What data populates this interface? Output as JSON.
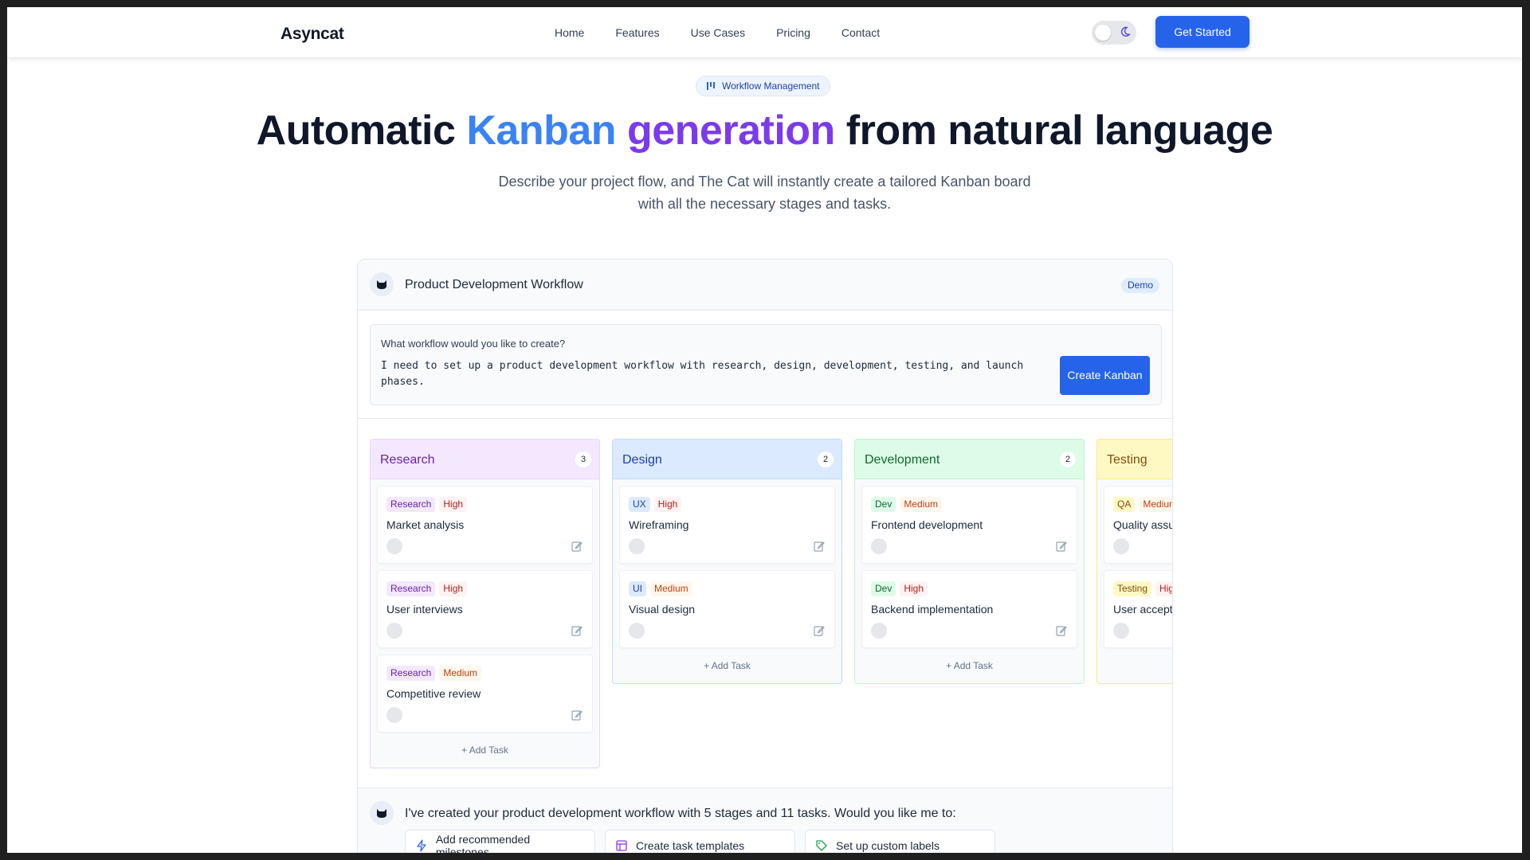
{
  "nav": {
    "brand": "Asyncat",
    "links": [
      "Home",
      "Features",
      "Use Cases",
      "Pricing",
      "Contact"
    ],
    "cta": "Get Started"
  },
  "hero": {
    "pill": "Workflow Management",
    "title_before": "Automatic ",
    "title_word1": "Kanban",
    "title_word2": "generation",
    "title_after": " from natural language",
    "subtitle_line1": "Describe your project flow, and The Cat will instantly create a tailored Kanban board",
    "subtitle_line2": "with all the necessary stages and tasks."
  },
  "demo": {
    "title": "Product Development Workflow",
    "badge": "Demo",
    "prompt_label": "What workflow would you like to create?",
    "prompt_text": "I need to set up a product development workflow with research, design, development, testing, and launch phases.",
    "create_button": "Create Kanban",
    "add_task_label": "+ Add Task"
  },
  "columns": [
    {
      "name": "Research",
      "count": "3",
      "head_bg": "#f3e8ff",
      "name_color": "#6b21a8",
      "border": "#e9d5ff",
      "cards": [
        {
          "tags": [
            {
              "text": "Research",
              "bg": "#f3e8ff",
              "color": "#6b21a8"
            },
            {
              "text": "High",
              "bg": "#fef2f2",
              "color": "#b91c1c"
            }
          ],
          "title": "Market analysis"
        },
        {
          "tags": [
            {
              "text": "Research",
              "bg": "#f3e8ff",
              "color": "#6b21a8"
            },
            {
              "text": "High",
              "bg": "#fef2f2",
              "color": "#b91c1c"
            }
          ],
          "title": "User interviews"
        },
        {
          "tags": [
            {
              "text": "Research",
              "bg": "#f3e8ff",
              "color": "#6b21a8"
            },
            {
              "text": "Medium",
              "bg": "#fff7ed",
              "color": "#c2410c"
            }
          ],
          "title": "Competitive review"
        }
      ]
    },
    {
      "name": "Design",
      "count": "2",
      "head_bg": "#dbeafe",
      "name_color": "#1e40af",
      "border": "#bfdbfe",
      "cards": [
        {
          "tags": [
            {
              "text": "UX",
              "bg": "#dbeafe",
              "color": "#1e40af"
            },
            {
              "text": "High",
              "bg": "#fef2f2",
              "color": "#b91c1c"
            }
          ],
          "title": "Wireframing"
        },
        {
          "tags": [
            {
              "text": "UI",
              "bg": "#dbeafe",
              "color": "#1e40af"
            },
            {
              "text": "Medium",
              "bg": "#fff7ed",
              "color": "#c2410c"
            }
          ],
          "title": "Visual design"
        }
      ]
    },
    {
      "name": "Development",
      "count": "2",
      "head_bg": "#dcfce7",
      "name_color": "#166534",
      "border": "#bbf7d0",
      "cards": [
        {
          "tags": [
            {
              "text": "Dev",
              "bg": "#dcfce7",
              "color": "#166534"
            },
            {
              "text": "Medium",
              "bg": "#fff7ed",
              "color": "#c2410c"
            }
          ],
          "title": "Frontend development"
        },
        {
          "tags": [
            {
              "text": "Dev",
              "bg": "#dcfce7",
              "color": "#166534"
            },
            {
              "text": "High",
              "bg": "#fef2f2",
              "color": "#b91c1c"
            }
          ],
          "title": "Backend implementation"
        }
      ]
    },
    {
      "name": "Testing",
      "count": "",
      "head_bg": "#fef9c3",
      "name_color": "#854d0e",
      "border": "#fde68a",
      "cards": [
        {
          "tags": [
            {
              "text": "QA",
              "bg": "#fef9c3",
              "color": "#854d0e"
            },
            {
              "text": "Medium",
              "bg": "#fff7ed",
              "color": "#c2410c"
            }
          ],
          "title": "Quality assurance"
        },
        {
          "tags": [
            {
              "text": "Testing",
              "bg": "#fef9c3",
              "color": "#854d0e"
            },
            {
              "text": "High",
              "bg": "#fef2f2",
              "color": "#b91c1c"
            }
          ],
          "title": "User acceptance testing"
        }
      ]
    }
  ],
  "message": {
    "text": "I've created your product development workflow with 5 stages and 11 tasks. Would you like me to:",
    "suggestions": [
      {
        "label": "Add recommended milestones",
        "icon": "lightning-icon"
      },
      {
        "label": "Create task templates",
        "icon": "template-icon"
      },
      {
        "label": "Set up custom labels",
        "icon": "tag-icon"
      }
    ]
  },
  "colors": {
    "primary": "#2563eb",
    "title_blue": "#3b82f6",
    "title_purple": "#7c3aed"
  }
}
